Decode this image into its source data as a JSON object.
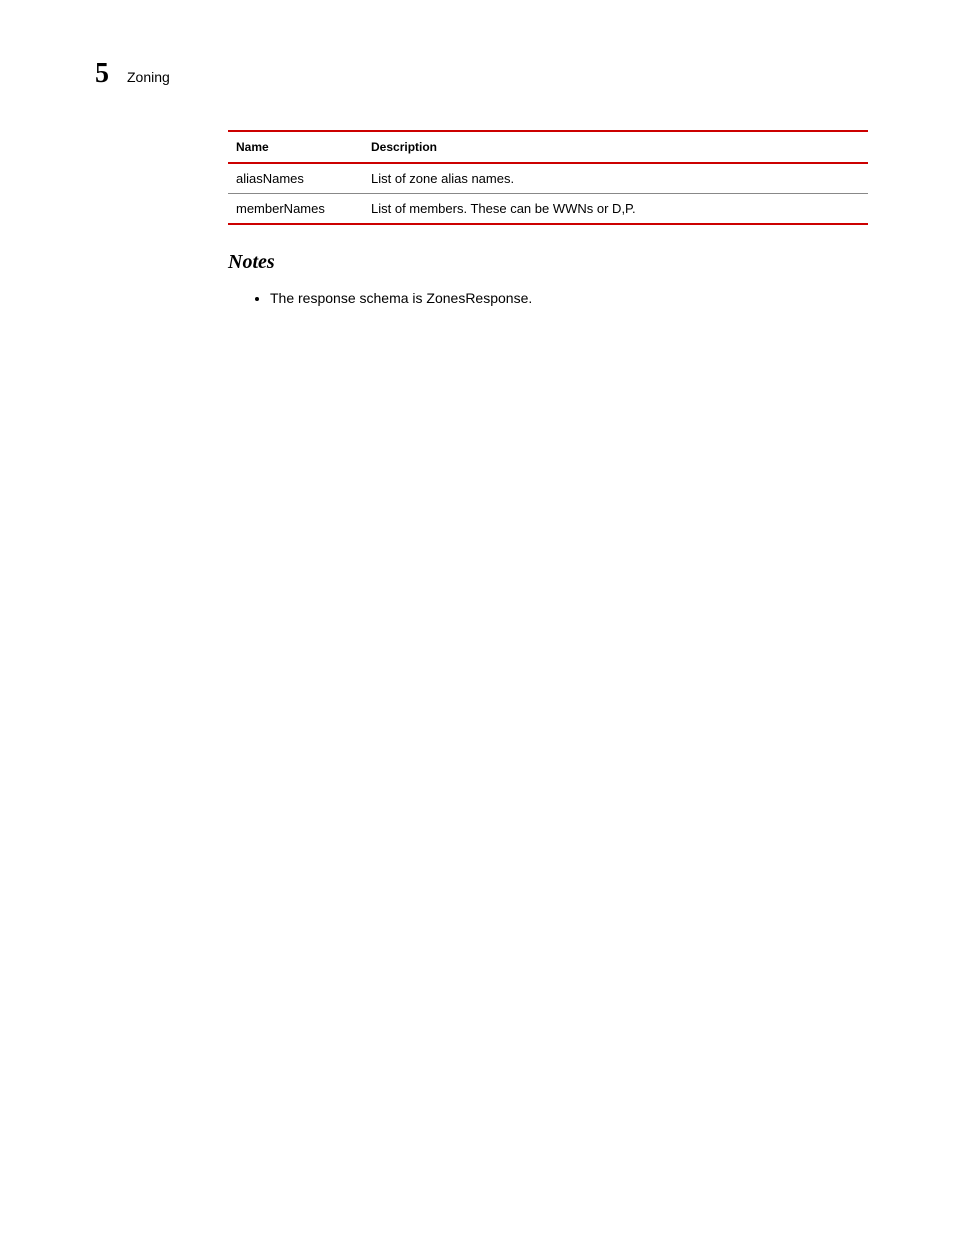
{
  "header": {
    "chapter_number": "5",
    "chapter_title": "Zoning"
  },
  "table": {
    "columns": [
      "Name",
      "Description"
    ],
    "rows": [
      {
        "name": "aliasNames",
        "description": "List of zone alias names."
      },
      {
        "name": "memberNames",
        "description": "List of members. These can be WWNs or D,P."
      }
    ]
  },
  "notes": {
    "heading": "Notes",
    "items": [
      "The response schema is ZonesResponse."
    ]
  }
}
